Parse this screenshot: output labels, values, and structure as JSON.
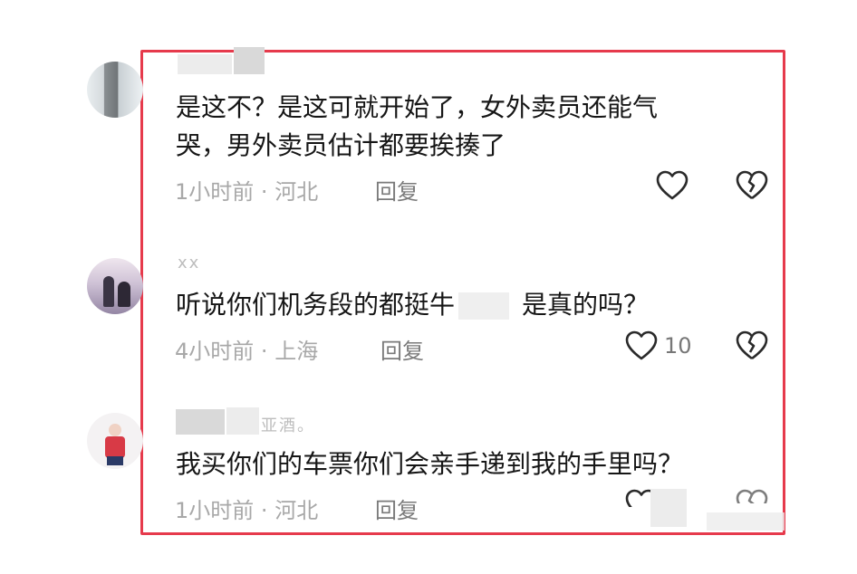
{
  "comments": [
    {
      "text_line1": "是这不？是这可就开始了，女外卖员还能气",
      "text_line2": "哭，男外卖员估计都要挨揍了",
      "time": "1小时前",
      "location": "河北",
      "reply_label": "回复",
      "like_count": ""
    },
    {
      "username": "xx",
      "text_part1": "听说你们机务段的都挺牛",
      "text_part2": "是真的吗？",
      "time": "4小时前",
      "location": "上海",
      "reply_label": "回复",
      "like_count": "10"
    },
    {
      "username_suffix": "亚酒。",
      "text_line1": "我买你们的车票你们会亲手递到我的手里吗？",
      "time": "1小时前",
      "location": "河北",
      "reply_label": "回复",
      "like_count": ""
    }
  ],
  "separator": "·",
  "colors": {
    "frame_red": "#e63a4c",
    "meta_gray": "#a8a8a8",
    "text_black": "#161616"
  },
  "icons": {
    "like": "heart-outline-icon",
    "dislike": "broken-heart-icon"
  }
}
